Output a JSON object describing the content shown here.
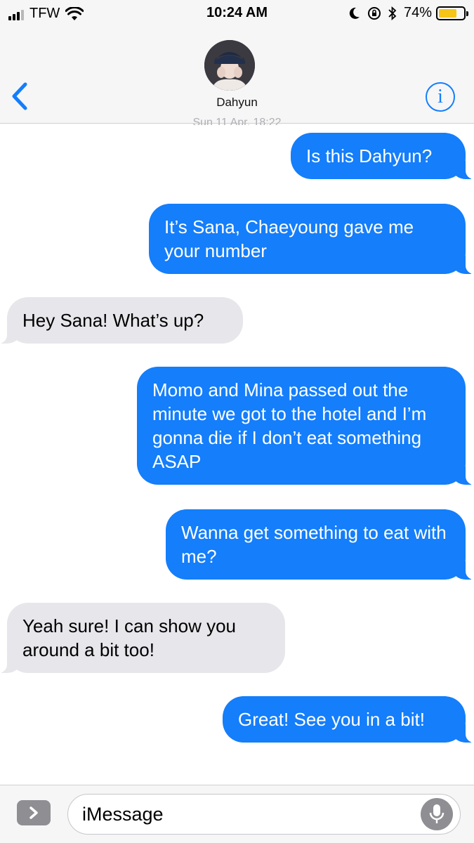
{
  "status_bar": {
    "carrier": "TFW",
    "time": "10:24 AM",
    "battery_percent": "74%",
    "battery_level": 0.74,
    "icons": [
      "signal-icon",
      "wifi-icon",
      "moon-icon",
      "rotation-lock-icon",
      "bluetooth-icon",
      "battery-icon"
    ]
  },
  "header": {
    "contact_name": "Dahyun",
    "back_icon": "chevron-left-icon",
    "info_icon": "info-icon",
    "info_glyph": "i",
    "timestamp_peek": "Sun 11 Apr, 18:22"
  },
  "messages": [
    {
      "direction": "out",
      "text": "Is this Dahyun?"
    },
    {
      "direction": "out",
      "text": "It’s Sana, Chaeyoung gave me your number"
    },
    {
      "direction": "in",
      "text": "Hey Sana! What’s up?"
    },
    {
      "direction": "out",
      "text": "Momo and Mina passed out the minute we got to the hotel and I’m gonna die if I don’t eat something ASAP"
    },
    {
      "direction": "out",
      "text": "Wanna get something to eat with me?"
    },
    {
      "direction": "in",
      "text": "Yeah sure! I can show you around a bit too!"
    },
    {
      "direction": "out",
      "text": "Great! See you in a bit!"
    }
  ],
  "input": {
    "placeholder": "iMessage",
    "apps_icon": "chevron-right-icon",
    "mic_icon": "microphone-icon"
  },
  "colors": {
    "outgoing_bubble": "#147efb",
    "incoming_bubble": "#e6e6eb",
    "accent": "#147efb",
    "battery": "#f5c518"
  }
}
